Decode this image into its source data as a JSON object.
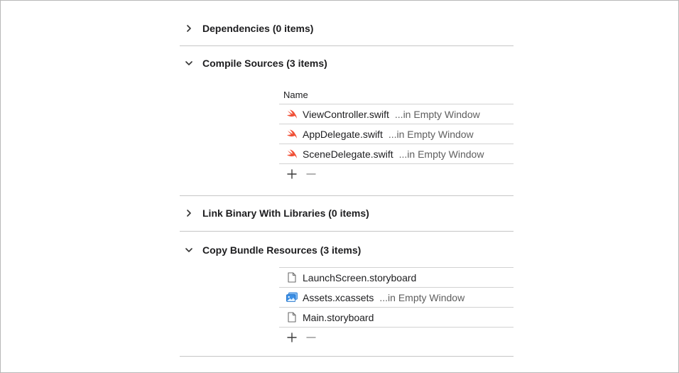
{
  "sections": [
    {
      "title": "Dependencies (0 items)",
      "expanded": false
    },
    {
      "title": "Compile Sources (3 items)",
      "expanded": true
    },
    {
      "title": "Link Binary With Libraries (0 items)",
      "expanded": false
    },
    {
      "title": "Copy Bundle Resources (3 items)",
      "expanded": true
    }
  ],
  "compile_sources": {
    "column_header": "Name",
    "rows": [
      {
        "name": "ViewController.swift",
        "detail": "...in Empty Window",
        "icon": "swift-icon"
      },
      {
        "name": "AppDelegate.swift",
        "detail": "...in Empty Window",
        "icon": "swift-icon"
      },
      {
        "name": "SceneDelegate.swift",
        "detail": "...in Empty Window",
        "icon": "swift-icon"
      }
    ]
  },
  "bundle_resources": {
    "rows": [
      {
        "name": "LaunchScreen.storyboard",
        "detail": "",
        "icon": "document-icon"
      },
      {
        "name": "Assets.xcassets",
        "detail": "...in Empty Window",
        "icon": "asset-catalog-icon"
      },
      {
        "name": "Main.storyboard",
        "detail": "",
        "icon": "document-icon"
      }
    ]
  },
  "colors": {
    "swift": "#f05138",
    "asset": "#3b8fe6",
    "divider": "#c6c6c6"
  }
}
